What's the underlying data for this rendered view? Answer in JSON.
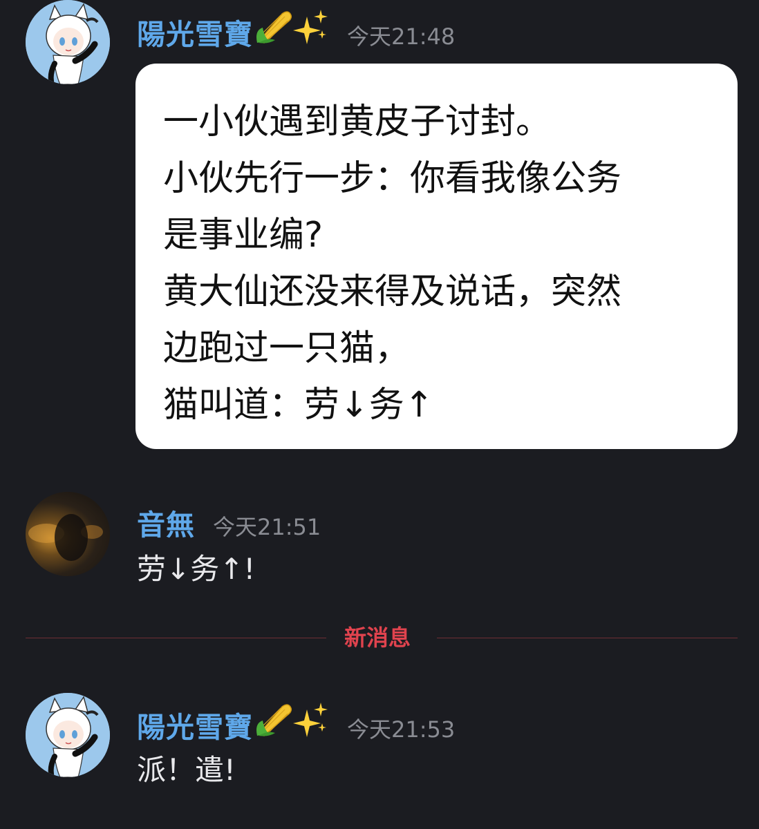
{
  "messages": [
    {
      "username": "陽光雪寶",
      "emojis": [
        "corn-emoji",
        "sparkles-emoji"
      ],
      "timestamp": "今天21:48",
      "image_card": {
        "lines": [
          "一小伙遇到黄皮子讨封。",
          "小伙先行一步：你看我像公务",
          "是事业编?",
          "黄大仙还没来得及说话，突然",
          "边跑过一只猫，",
          "猫叫道：劳↓务↑"
        ]
      }
    },
    {
      "username": "音無",
      "timestamp": "今天21:51",
      "text": "劳↓务↑!"
    },
    {
      "username": "陽光雪寶",
      "emojis": [
        "corn-emoji",
        "sparkles-emoji"
      ],
      "timestamp": "今天21:53",
      "text": "派！遣!"
    }
  ],
  "divider": {
    "label": "新消息"
  },
  "colors": {
    "background": "#1b1c21",
    "username": "#5fa8ea",
    "timestamp": "#8a8c93",
    "new_message_divider": "#e0434e"
  }
}
